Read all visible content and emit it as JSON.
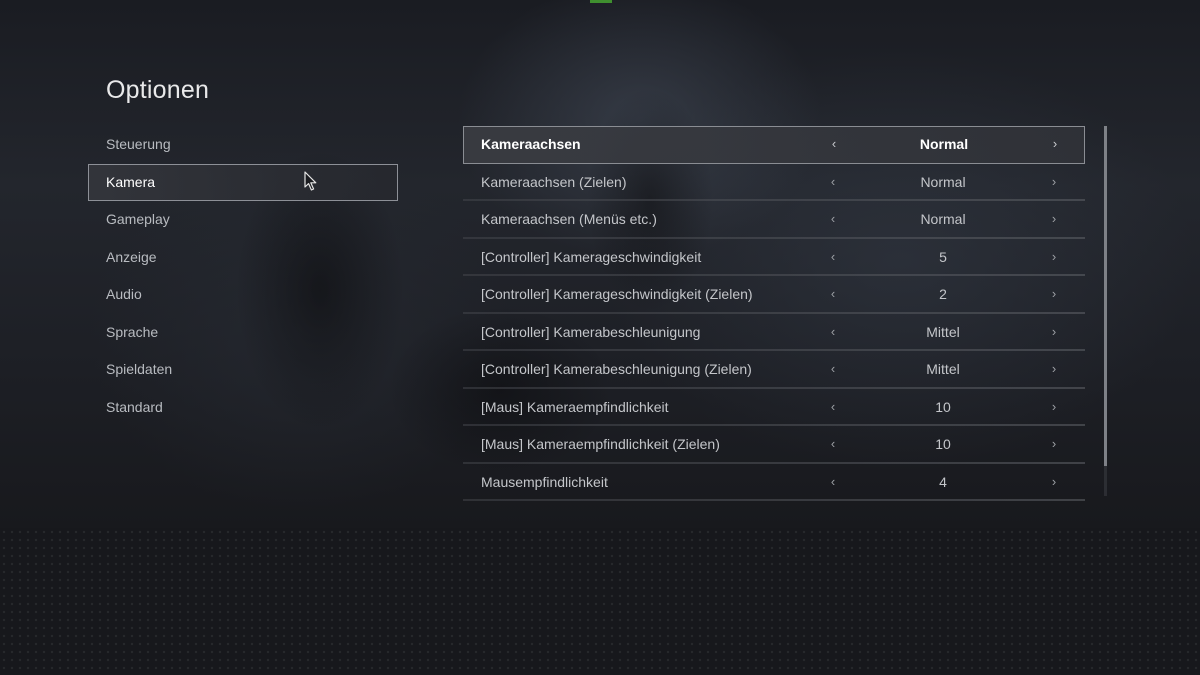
{
  "page": {
    "title": "Optionen"
  },
  "menu": {
    "items": [
      {
        "label": "Steuerung",
        "active": false
      },
      {
        "label": "Kamera",
        "active": true
      },
      {
        "label": "Gameplay",
        "active": false
      },
      {
        "label": "Anzeige",
        "active": false
      },
      {
        "label": "Audio",
        "active": false
      },
      {
        "label": "Sprache",
        "active": false
      },
      {
        "label": "Spieldaten",
        "active": false
      },
      {
        "label": "Standard",
        "active": false
      }
    ]
  },
  "settings": {
    "arrow_left": "‹",
    "arrow_right": "›",
    "rows": [
      {
        "label": "Kameraachsen",
        "value": "Normal",
        "selected": true
      },
      {
        "label": "Kameraachsen (Zielen)",
        "value": "Normal",
        "selected": false
      },
      {
        "label": "Kameraachsen (Menüs etc.)",
        "value": "Normal",
        "selected": false
      },
      {
        "label": "[Controller] Kamerageschwindigkeit",
        "value": "5",
        "selected": false
      },
      {
        "label": "[Controller] Kamerageschwindigkeit (Zielen)",
        "value": "2",
        "selected": false
      },
      {
        "label": "[Controller] Kamerabeschleunigung",
        "value": "Mittel",
        "selected": false
      },
      {
        "label": "[Controller] Kamerabeschleunigung (Zielen)",
        "value": "Mittel",
        "selected": false
      },
      {
        "label": "[Maus] Kameraempfindlichkeit",
        "value": "10",
        "selected": false
      },
      {
        "label": "[Maus] Kameraempfindlichkeit (Zielen)",
        "value": "10",
        "selected": false
      },
      {
        "label": "Mausempfindlichkeit",
        "value": "4",
        "selected": false
      }
    ]
  },
  "colors": {
    "accent_marker": "#3f8f2f",
    "selected_border": "#8a8d93",
    "text_primary": "#ffffff",
    "text_secondary": "#c4c6ca"
  },
  "icons": {
    "cursor": "mouse-pointer-icon",
    "arrow_left": "chevron-left-icon",
    "arrow_right": "chevron-right-icon"
  }
}
